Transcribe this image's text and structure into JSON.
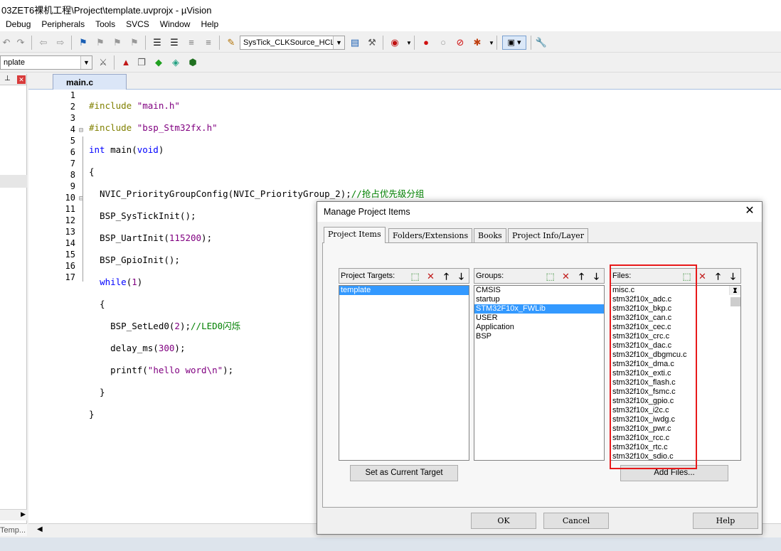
{
  "window": {
    "title": "03ZET6裸机工程\\Project\\template.uvprojx - µVision"
  },
  "menu": [
    "Debug",
    "Peripherals",
    "Tools",
    "SVCS",
    "Window",
    "Help"
  ],
  "toolbar": {
    "target_combo": "SysTick_CLKSource_HCLK",
    "project_combo": "nplate"
  },
  "left_pane": {
    "tab_label": "Temp..."
  },
  "editor": {
    "tab_label": "main.c",
    "line_numbers": [
      "1",
      "2",
      "3",
      "4",
      "5",
      "6",
      "7",
      "8",
      "9",
      "10",
      "11",
      "12",
      "13",
      "14",
      "15",
      "16",
      "17"
    ]
  },
  "dialog": {
    "title": "Manage Project Items",
    "tabs": [
      "Project Items",
      "Folders/Extensions",
      "Books",
      "Project Info/Layer"
    ],
    "targets": {
      "label": "Project Targets:",
      "items": [
        "template"
      ],
      "selected": 0
    },
    "groups": {
      "label": "Groups:",
      "items": [
        "CMSIS",
        "startup",
        "STM32F10x_FWLib",
        "USER",
        "Application",
        "BSP"
      ],
      "selected": 2
    },
    "files": {
      "label": "Files:",
      "items": [
        "misc.c",
        "stm32f10x_adc.c",
        "stm32f10x_bkp.c",
        "stm32f10x_can.c",
        "stm32f10x_cec.c",
        "stm32f10x_crc.c",
        "stm32f10x_dac.c",
        "stm32f10x_dbgmcu.c",
        "stm32f10x_dma.c",
        "stm32f10x_exti.c",
        "stm32f10x_flash.c",
        "stm32f10x_fsmc.c",
        "stm32f10x_gpio.c",
        "stm32f10x_i2c.c",
        "stm32f10x_iwdg.c",
        "stm32f10x_pwr.c",
        "stm32f10x_rcc.c",
        "stm32f10x_rtc.c",
        "stm32f10x_sdio.c"
      ]
    },
    "set_target_label": "Set as Current Target",
    "add_files_label": "Add Files...",
    "ok_label": "OK",
    "cancel_label": "Cancel",
    "help_label": "Help"
  },
  "colors": {
    "highlight_box": "#e8191a",
    "selection": "#3399ff"
  }
}
